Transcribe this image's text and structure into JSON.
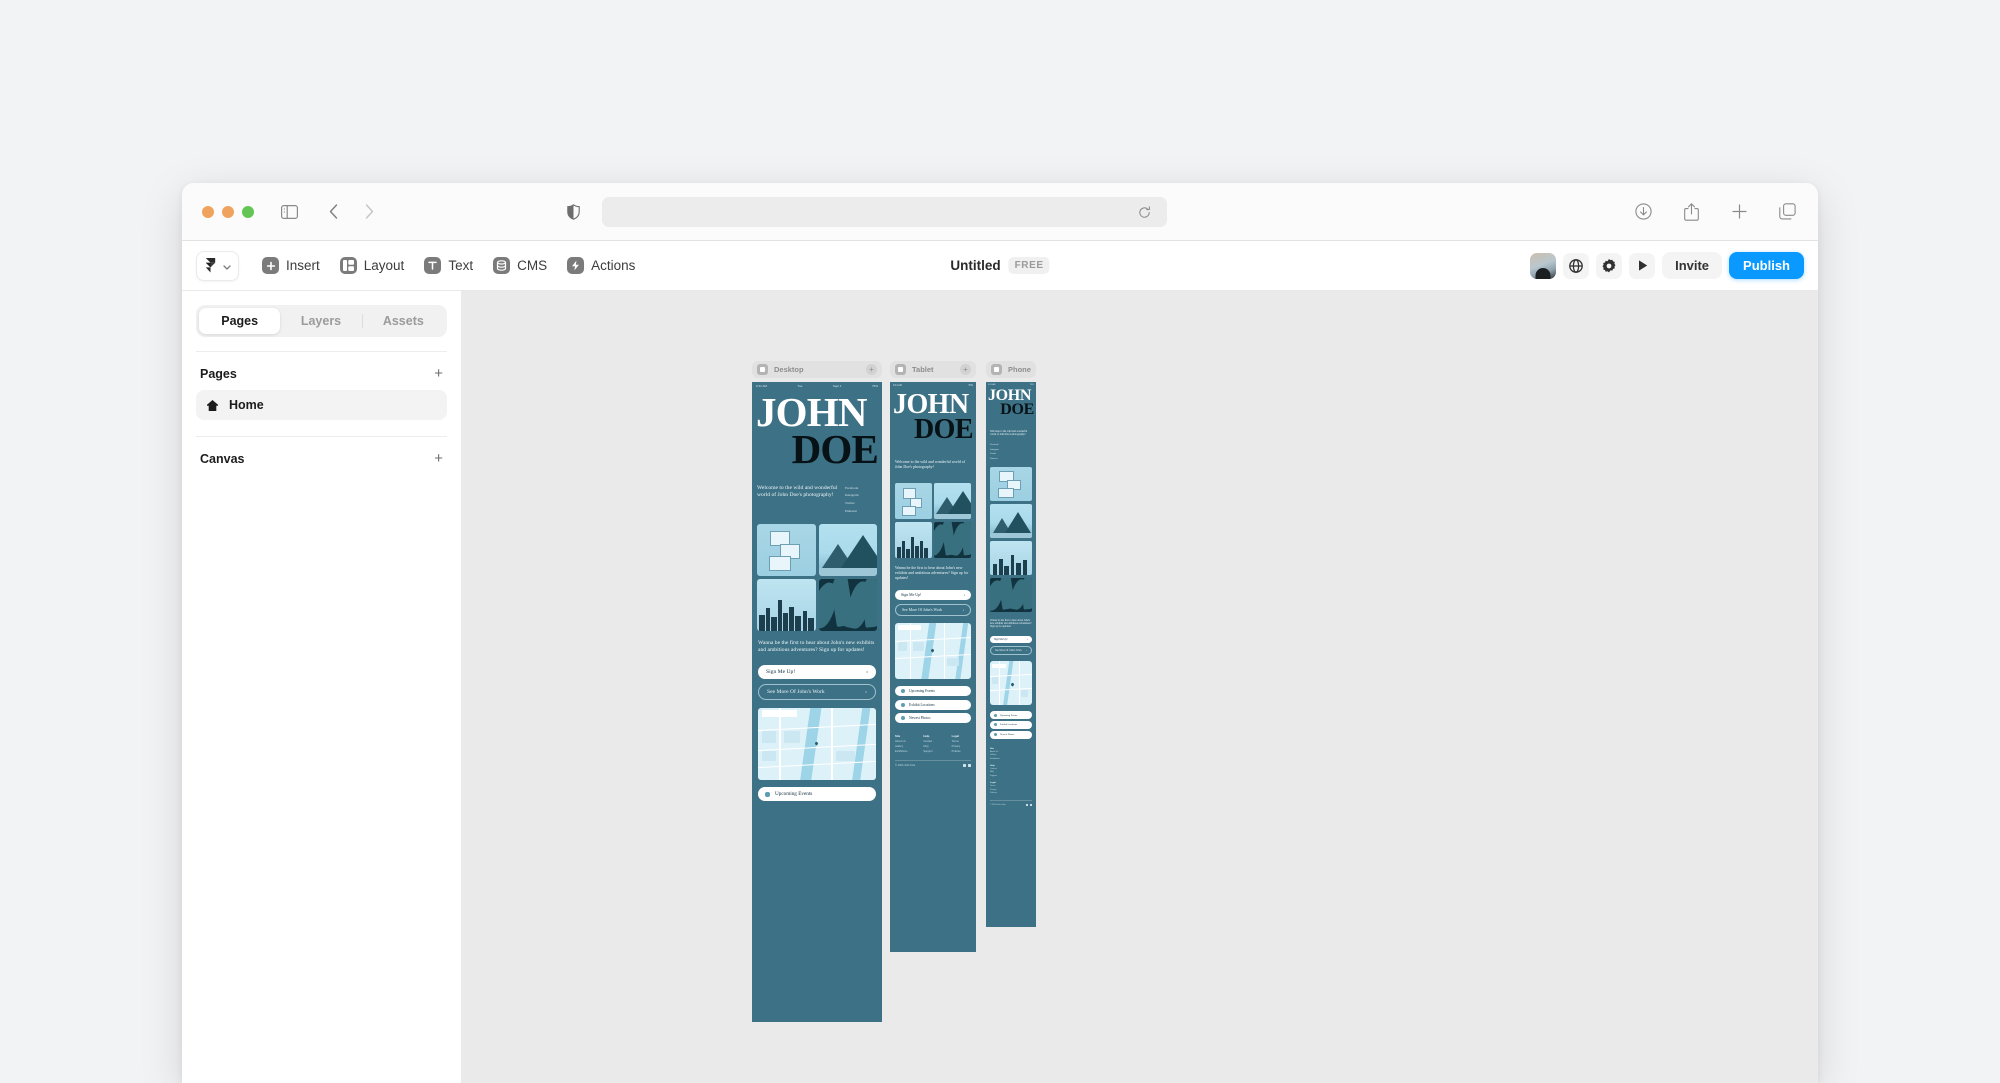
{
  "browser": {
    "url_value": "",
    "url_placeholder": "",
    "icons": {
      "sidebar": "sidebar-toggle-icon",
      "back": "back-arrow-icon",
      "forward": "forward-arrow-icon",
      "shield": "privacy-shield-icon",
      "reload": "reload-icon",
      "downloads": "downloads-icon",
      "share": "share-icon",
      "new_tab": "plus-icon",
      "tab_overview": "tab-overview-icon"
    }
  },
  "toolbar": {
    "logo_label": "Framer",
    "items": [
      {
        "label": "Insert",
        "icon": "insert-icon"
      },
      {
        "label": "Layout",
        "icon": "layout-icon"
      },
      {
        "label": "Text",
        "icon": "text-icon"
      },
      {
        "label": "CMS",
        "icon": "cms-icon"
      },
      {
        "label": "Actions",
        "icon": "actions-icon"
      }
    ],
    "title": "Untitled",
    "plan_badge": "FREE",
    "invite_label": "Invite",
    "publish_label": "Publish",
    "publish_color": "#0a99ff",
    "right_icons": [
      "avatar",
      "globe-icon",
      "gear-icon",
      "play-icon"
    ]
  },
  "sidebar": {
    "tabs": [
      {
        "label": "Pages",
        "active": true
      },
      {
        "label": "Layers",
        "active": false
      },
      {
        "label": "Assets",
        "active": false
      }
    ],
    "sections": [
      {
        "title": "Pages",
        "add": "+"
      },
      {
        "title": "Canvas",
        "add": "+"
      }
    ],
    "pages": [
      {
        "label": "Home",
        "icon": "home-icon",
        "selected": true
      }
    ]
  },
  "canvas": {
    "background": "#eaeaea",
    "frames": [
      {
        "name": "Desktop",
        "add": "+"
      },
      {
        "name": "Tablet",
        "add": "+"
      },
      {
        "name": "Phone",
        "add": "+"
      }
    ]
  },
  "site": {
    "status_bar": {
      "time": "9:41 AM",
      "carrier": "Tue",
      "date": "Sept 1",
      "battery": "76%"
    },
    "hero_line1": "JOHN",
    "hero_line2": "DOE",
    "intro": "Welcome to the wild and wonderful world of John Doe's photography!",
    "social": [
      "Facebook",
      "Instagram",
      "Twitter",
      "Pinterest"
    ],
    "photos": [
      {
        "alt": "brutalist-building-photo"
      },
      {
        "alt": "mountain-range-photo"
      },
      {
        "alt": "city-skyline-photo"
      },
      {
        "alt": "palm-leaves-photo"
      }
    ],
    "cta": "Wanna be the first to hear about John's new exhibits and ambitious adventures? Sign up for updates!",
    "buttons": [
      {
        "label": "Sign Me Up!",
        "style": "solid",
        "chevron": "›"
      },
      {
        "label": "See More Of John's Work",
        "style": "ghost",
        "chevron": "›"
      }
    ],
    "map_alt": "city-street-map",
    "list_items": [
      {
        "label": "Upcoming Events",
        "icon": "calendar-icon"
      },
      {
        "label": "Exhibit Locations",
        "icon": "building-icon"
      },
      {
        "label": "Newest Photos",
        "icon": "camera-icon"
      }
    ],
    "footer": {
      "columns": [
        {
          "title": "Site",
          "links": [
            "About Us",
            "Gallery",
            "Exhibitions"
          ]
        },
        {
          "title": "Help",
          "links": [
            "Contact",
            "FAQ",
            "Support"
          ]
        },
        {
          "title": "Legal",
          "links": [
            "Terms",
            "Privacy",
            "Policies"
          ]
        }
      ],
      "copyright": "© 2024 John Doe"
    },
    "colors": {
      "page_bg": "#3d7185",
      "hero_light": "#ffffff",
      "hero_dark": "#061216",
      "photo_light": "#a9d6e6"
    }
  }
}
